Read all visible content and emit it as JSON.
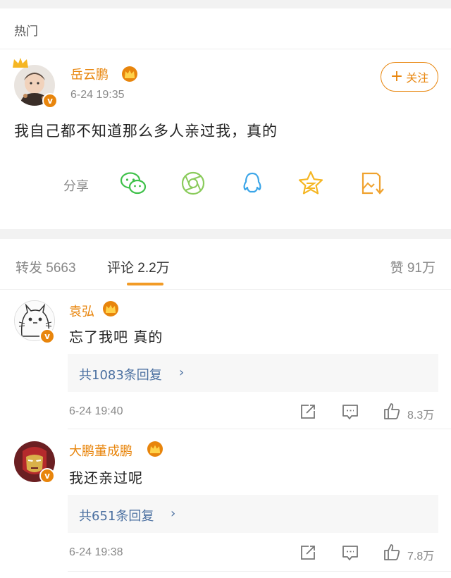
{
  "header": {
    "label": "热门"
  },
  "post": {
    "author": "岳云鹏",
    "time": "6-24 19:35",
    "follow_label": "关注",
    "follow_plus": "+",
    "verified_mark": "v",
    "text": "我自己都不知道那么多人亲过我，真的",
    "share_label": "分享",
    "share_icons": [
      "wechat-icon",
      "moments-icon",
      "qq-icon",
      "qzone-icon",
      "save-image-icon"
    ]
  },
  "tabs": {
    "repost": "转发 5663",
    "comments": "评论 2.2万",
    "likes": "赞 91万"
  },
  "comments": [
    {
      "author": "袁弘",
      "text": "忘了我吧 真的",
      "replies": "共1083条回复",
      "time": "6-24 19:40",
      "likes": "8.3万"
    },
    {
      "author": "大鹏董成鹏",
      "text": "我还亲过呢",
      "replies": "共651条回复",
      "time": "6-24 19:38",
      "likes": "7.8万"
    }
  ],
  "chevron": "›",
  "colors": {
    "accent": "#e8850c",
    "link": "#4a6fa0",
    "underline": "#f29b26"
  }
}
